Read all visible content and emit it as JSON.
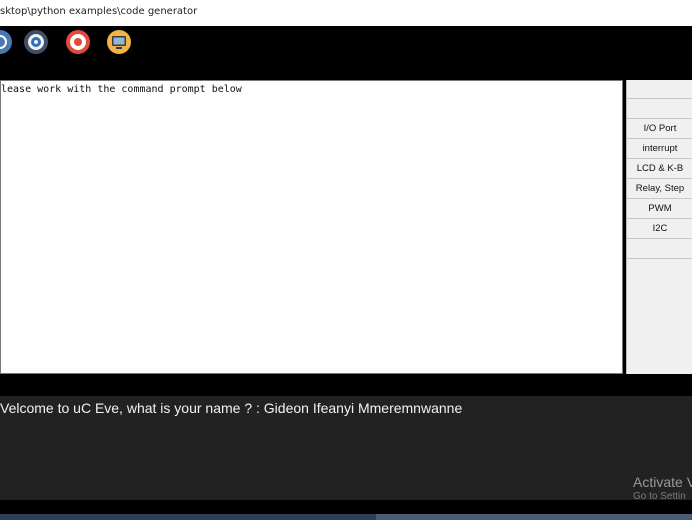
{
  "window": {
    "title": "sktop\\python examples\\code generator"
  },
  "toolbar": {
    "icons": [
      "refresh-icon",
      "settings-icon",
      "help-icon",
      "lightbulb-icon",
      "monitor-icon"
    ]
  },
  "editor": {
    "text": "lease work with the command prompt below"
  },
  "sidebar": {
    "items": [
      {
        "label": ""
      },
      {
        "label": "I/O Port"
      },
      {
        "label": "interrupt"
      },
      {
        "label": "LCD & K-B"
      },
      {
        "label": "Relay, Step"
      },
      {
        "label": "PWM"
      },
      {
        "label": "I2C"
      },
      {
        "label": ""
      }
    ]
  },
  "console": {
    "text": "Velcome to uC Eve, what is your name ? : Gideon Ifeanyi Mmeremnwanne"
  },
  "watermark": {
    "line1": "Activate V",
    "line2": "Go to Settin"
  }
}
